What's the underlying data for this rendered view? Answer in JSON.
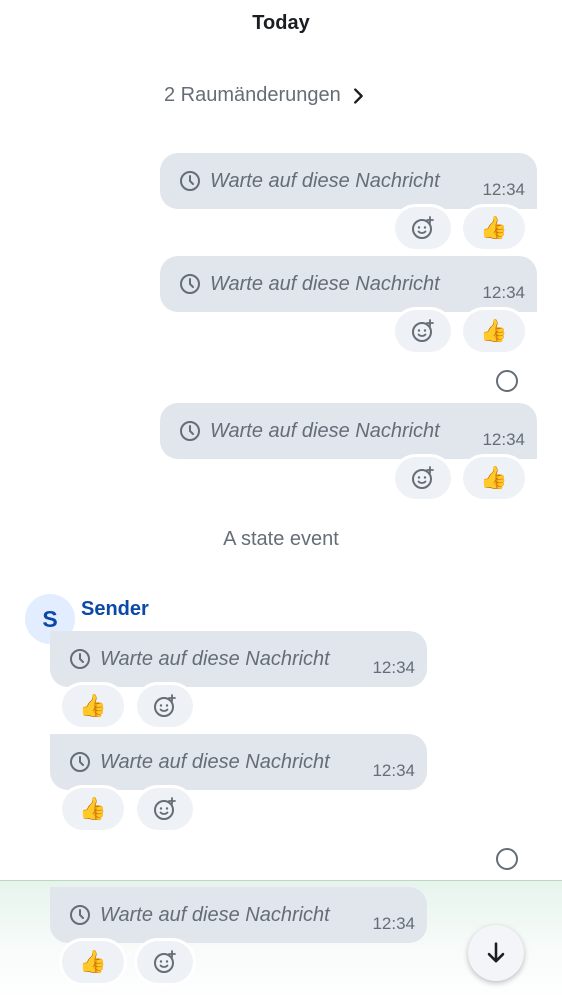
{
  "timeline": {
    "day_header": "Today",
    "room_changes_label": "2 Raumänderungen",
    "state_event": "A state event",
    "sender": {
      "name": "Sender",
      "avatar_initial": "S"
    },
    "message_text": "Warte auf diese Nachricht",
    "message_time": "12:34",
    "reaction_emoji": "👍"
  },
  "icons": {
    "clock": "clock-icon",
    "add_reaction": "add-reaction-icon",
    "chevron": "chevron-right-icon",
    "read_receipt": "read-receipt-circle",
    "scroll_down": "arrow-down-icon"
  },
  "colors": {
    "bubble": "#e1e6ec",
    "sender": "#0b49a6",
    "secondary_text": "#656d77"
  }
}
